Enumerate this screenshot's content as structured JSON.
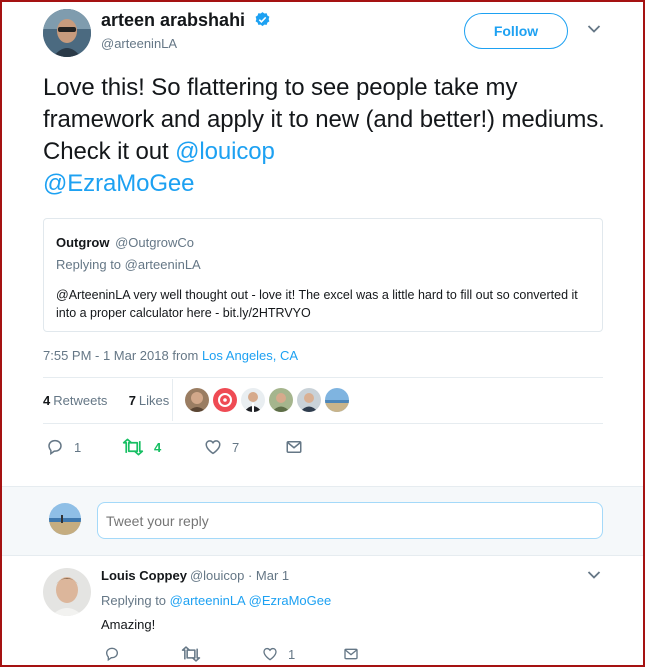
{
  "tweet": {
    "author_name": "arteen arabshahi",
    "author_handle": "@arteeninLA",
    "follow_label": "Follow",
    "text_plain": "Love this! So flattering to see people take my framework and apply it to new (and better!) mediums. Check it out ",
    "mention_1": "@louicop",
    "mention_2": "@EzraMoGee",
    "timestamp": "7:55 PM - 1 Mar 2018 from ",
    "location": "Los Angeles, CA",
    "retweets_count": "4",
    "retweets_label": "Retweets",
    "likes_count": "7",
    "likes_label": "Likes",
    "reply_count": "1",
    "retweet_action_count": "4",
    "like_action_count": "7"
  },
  "quote": {
    "author_name": "Outgrow",
    "author_handle": "@OutgrowCo",
    "replying_to": "Replying to @arteeninLA",
    "text": "@ArteeninLA very well thought out - love it! The excel was a little hard to fill out so converted it into a proper calculator here - bit.ly/2HTRVYO"
  },
  "reply_box": {
    "placeholder": "Tweet your reply"
  },
  "comment": {
    "author_name": "Louis Coppey",
    "author_handle": "@louicop",
    "date": " · Mar 1",
    "replying_prefix": "Replying to ",
    "replying_1": "@arteeninLA",
    "replying_2": "@EzraMoGee",
    "text": "Amazing!",
    "like_count": "1"
  },
  "colors": {
    "accent": "#1da1f2",
    "retweet_green": "#17bf63",
    "muted": "#657786",
    "frame": "#a51212"
  }
}
